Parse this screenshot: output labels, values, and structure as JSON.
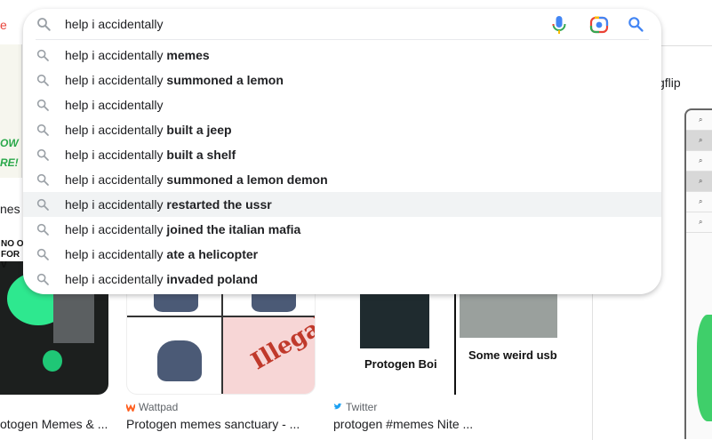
{
  "search": {
    "value": "help i accidentally",
    "placeholder": ""
  },
  "suggestions": [
    {
      "prefix": "help i accidentally",
      "completion": "memes"
    },
    {
      "prefix": "help i accidentally",
      "completion": "summoned a lemon"
    },
    {
      "prefix": "help i accidentally",
      "completion": ""
    },
    {
      "prefix": "help i accidentally",
      "completion": "built a jeep"
    },
    {
      "prefix": "help i accidentally",
      "completion": "built a shelf"
    },
    {
      "prefix": "help i accidentally",
      "completion": "summoned a lemon demon"
    },
    {
      "prefix": "help i accidentally",
      "completion": "restarted the ussr"
    },
    {
      "prefix": "help i accidentally",
      "completion": "joined the italian mafia"
    },
    {
      "prefix": "help i accidentally",
      "completion": "ate a helicopter"
    },
    {
      "prefix": "help i accidentally",
      "completion": "invaded poland"
    }
  ],
  "highlighted_index": 6,
  "background": {
    "left_label": "nes",
    "left_doodle": [
      "OW",
      "RE!"
    ],
    "left_bubble": [
      "NO O",
      "FOR V"
    ],
    "imgflip_label": "gflip",
    "mid_image_text": "Illegal",
    "right_captions": [
      "Protogen Boi",
      "Some weird usb"
    ],
    "results": [
      {
        "source": "",
        "title": "otogen Memes & ..."
      },
      {
        "source": "Wattpad",
        "title": "Protogen memes sanctuary - ..."
      },
      {
        "source": "Twitter",
        "title": "protogen #memes Nite ..."
      }
    ]
  },
  "colors": {
    "highlight_row": "#f1f3f4",
    "search_icon": "#9aa0a6",
    "go_icon": "#4285f4",
    "wattpad": "#ff6122",
    "twitter": "#1da1f2"
  }
}
